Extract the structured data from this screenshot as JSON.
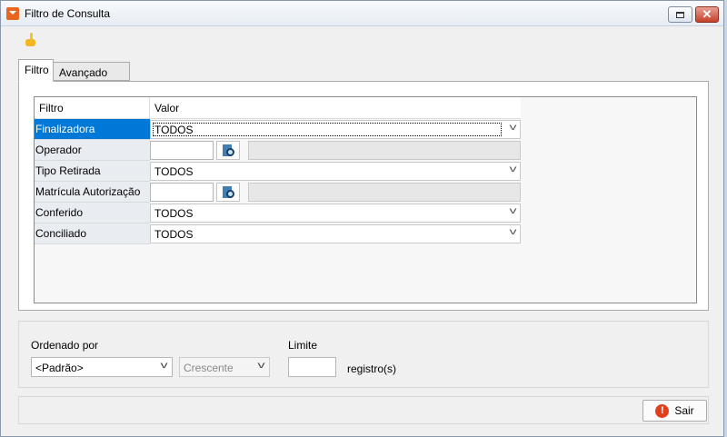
{
  "window": {
    "title": "Filtro de Consulta"
  },
  "tabs": [
    {
      "label": "Filtro",
      "active": true
    },
    {
      "label": "Avançado",
      "active": false
    }
  ],
  "grid": {
    "headers": [
      "Filtro",
      "Valor"
    ],
    "rows": [
      {
        "label": "Finalizadora",
        "type": "combo",
        "value": "TODOS",
        "selected": true
      },
      {
        "label": "Operador",
        "type": "lookup",
        "value": ""
      },
      {
        "label": "Tipo Retirada",
        "type": "combo",
        "value": "TODOS"
      },
      {
        "label": "Matrícula Autorização",
        "type": "lookup",
        "value": ""
      },
      {
        "label": "Conferido",
        "type": "combo",
        "value": "TODOS"
      },
      {
        "label": "Conciliado",
        "type": "combo",
        "value": "TODOS"
      }
    ]
  },
  "sort": {
    "order_label": "Ordenado por",
    "order_value": "<Padrão>",
    "direction_value": "Crescente",
    "limit_label": "Limite",
    "limit_value": "",
    "limit_suffix": "registro(s)"
  },
  "footer": {
    "exit_label": "Sair"
  },
  "colors": {
    "selection": "#0078d7",
    "close_button": "#c4412b",
    "exit_icon": "#e2401c"
  },
  "icons": [
    "app-icon",
    "hand-pointer-icon",
    "lookup-search-icon",
    "stop-icon"
  ]
}
